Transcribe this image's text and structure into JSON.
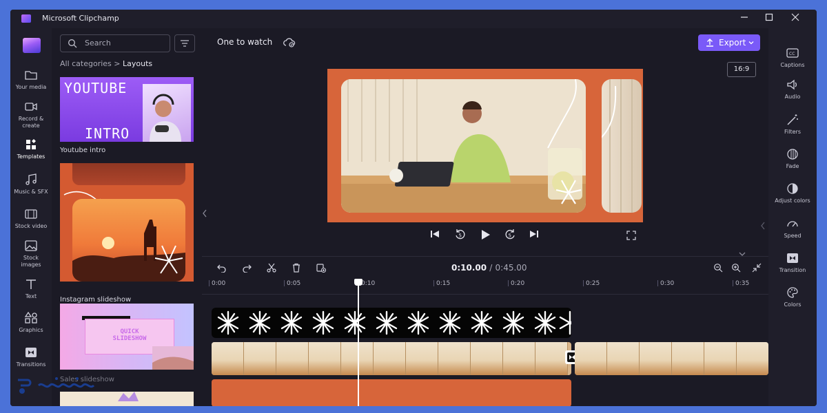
{
  "window": {
    "title": "Microsoft Clipchamp",
    "controls": [
      "minimize",
      "maximize",
      "close"
    ]
  },
  "left_nav": {
    "items": [
      {
        "label": "Your media",
        "icon": "folder-icon"
      },
      {
        "label": "Record & create",
        "icon": "camera-icon"
      },
      {
        "label": "Templates",
        "icon": "templates-icon",
        "active": true
      },
      {
        "label": "Music & SFX",
        "icon": "music-icon"
      },
      {
        "label": "Stock video",
        "icon": "film-icon"
      },
      {
        "label": "Stock images",
        "icon": "image-icon"
      },
      {
        "label": "Text",
        "icon": "text-icon"
      },
      {
        "label": "Graphics",
        "icon": "shapes-icon"
      },
      {
        "label": "Transitions",
        "icon": "transition-icon"
      }
    ]
  },
  "templates_panel": {
    "search_placeholder": "Search",
    "breadcrumb": {
      "parent": "All categories",
      "separator": ">",
      "current": "Layouts"
    },
    "templates": [
      {
        "title": "Youtube intro",
        "thumb_text": [
          "YOUTUBE",
          "INTRO"
        ]
      },
      {
        "title": "Instagram slideshow"
      },
      {
        "title": "Sales slideshow",
        "thumb_text": [
          "QUICK",
          "SLIDESHOW"
        ]
      }
    ]
  },
  "preview": {
    "project_name": "One to watch",
    "export_label": "Export",
    "aspect_ratio": "16:9"
  },
  "right_rail": {
    "items": [
      {
        "label": "Captions",
        "icon": "captions-icon"
      },
      {
        "label": "Audio",
        "icon": "speaker-icon"
      },
      {
        "label": "Filters",
        "icon": "magic-wand-icon"
      },
      {
        "label": "Fade",
        "icon": "fade-icon"
      },
      {
        "label": "Adjust colors",
        "icon": "contrast-icon"
      },
      {
        "label": "Speed",
        "icon": "speedometer-icon"
      },
      {
        "label": "Transition",
        "icon": "transition-icon"
      },
      {
        "label": "Colors",
        "icon": "palette-icon"
      }
    ]
  },
  "timeline": {
    "current_time": "0:10.00",
    "separator": "/",
    "total_time": "0:45.00",
    "ruler": [
      "0:00",
      "0:05",
      "0:10",
      "0:15",
      "0:20",
      "0:25",
      "0:30",
      "0:35"
    ]
  },
  "colors": {
    "accent": "#7a5af8",
    "preview_bg": "#d7653a",
    "page_bg": "#4b72d8"
  }
}
